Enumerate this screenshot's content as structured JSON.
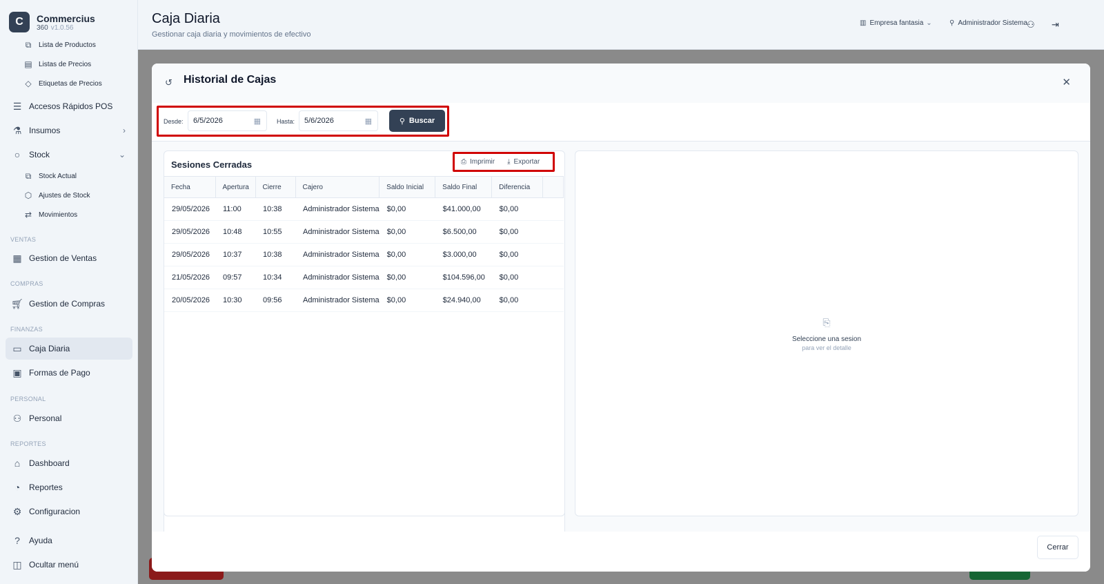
{
  "brand": {
    "logo_letter": "C",
    "name": "Commercius",
    "sub": "360",
    "version": "v1.0.56"
  },
  "sidebar": {
    "items_top": [
      {
        "label": "Lista de Productos",
        "icon": "boxes-icon"
      },
      {
        "label": "Listas de Precios",
        "icon": "banknote-icon"
      },
      {
        "label": "Etiquetas de Precios",
        "icon": "tag-icon"
      }
    ],
    "accesos": "Accesos Rápidos POS",
    "insumos": "Insumos",
    "stock": "Stock",
    "stock_items": [
      "Stock Actual",
      "Ajustes de Stock",
      "Movimientos"
    ],
    "sections": {
      "ventas": "VENTAS",
      "compras": "COMPRAS",
      "finanzas": "FINANZAS",
      "personal": "PERSONAL",
      "reportes": "REPORTES"
    },
    "gestion_ventas": "Gestion de Ventas",
    "gestion_compras": "Gestion de Compras",
    "caja_diaria": "Caja Diaria",
    "formas_pago": "Formas de Pago",
    "personal": "Personal",
    "dashboard": "Dashboard",
    "reportes": "Reportes",
    "configuracion": "Configuracion",
    "ayuda": "Ayuda",
    "ocultar": "Ocultar menú"
  },
  "header": {
    "title": "Caja Diaria",
    "subtitle": "Gestionar caja diaria y movimientos de efectivo",
    "empresa": "Empresa fantasia",
    "user": "Administrador Sistema"
  },
  "modal": {
    "title": "Historial de Cajas",
    "desde_label": "Desde:",
    "desde_value": "6/5/2026",
    "hasta_label": "Hasta:",
    "hasta_value": "5/6/2026",
    "buscar": "Buscar",
    "panel_title": "Sesiones Cerradas",
    "imprimir": "Imprimir",
    "exportar": "Exportar",
    "columns": [
      "Fecha",
      "Apertura",
      "Cierre",
      "Cajero",
      "Saldo Inicial",
      "Saldo Final",
      "Diferencia"
    ],
    "rows": [
      [
        "29/05/2026",
        "11:00",
        "10:38",
        "Administrador Sistema",
        "$0,00",
        "$41.000,00",
        "$0,00"
      ],
      [
        "29/05/2026",
        "10:48",
        "10:55",
        "Administrador Sistema",
        "$0,00",
        "$6.500,00",
        "$0,00"
      ],
      [
        "29/05/2026",
        "10:37",
        "10:38",
        "Administrador Sistema",
        "$0,00",
        "$3.000,00",
        "$0,00"
      ],
      [
        "21/05/2026",
        "09:57",
        "10:34",
        "Administrador Sistema",
        "$0,00",
        "$104.596,00",
        "$0,00"
      ],
      [
        "20/05/2026",
        "10:30",
        "09:56",
        "Administrador Sistema",
        "$0,00",
        "$24.940,00",
        "$0,00"
      ]
    ],
    "empty_title": "Seleccione una sesion",
    "empty_sub": "para ver el detalle",
    "cerrar": "Cerrar"
  }
}
